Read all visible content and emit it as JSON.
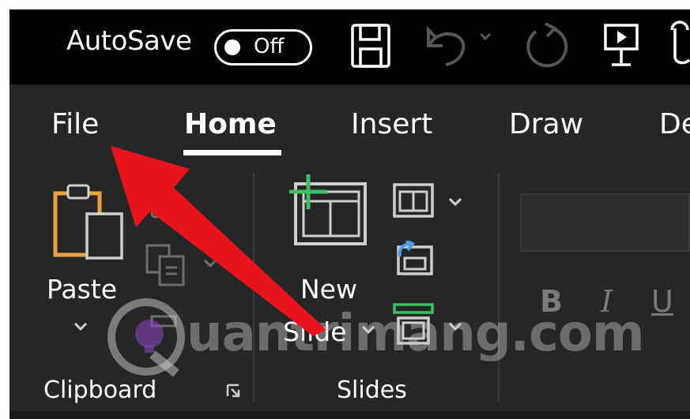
{
  "titlebar": {
    "autosave_label": "AutoSave",
    "autosave_state": "Off",
    "icons": [
      "save-icon",
      "undo-icon",
      "undo-dropdown-icon",
      "redo-icon",
      "presentation-icon",
      "touch-mode-icon"
    ]
  },
  "tabs": [
    {
      "label": "File",
      "selected": false
    },
    {
      "label": "Home",
      "selected": true
    },
    {
      "label": "Insert",
      "selected": false
    },
    {
      "label": "Draw",
      "selected": false
    },
    {
      "label": "De",
      "selected": false
    }
  ],
  "clipboard": {
    "paste_label": "Paste",
    "group_label": "Clipboard"
  },
  "slides": {
    "new_label": "New",
    "slide_label": "Slide",
    "group_label": "Slides"
  },
  "font": {
    "bold": "B",
    "italic": "I",
    "underline": "U"
  },
  "watermark": "uantrimang.com",
  "colors": {
    "titlebar_bg": "#000000",
    "ribbon_bg": "#262626",
    "accent_orange": "#e8a33d",
    "accent_green": "#3fbf5f",
    "accent_blue": "#4a9fe0",
    "arrow_red": "#e8141b"
  }
}
